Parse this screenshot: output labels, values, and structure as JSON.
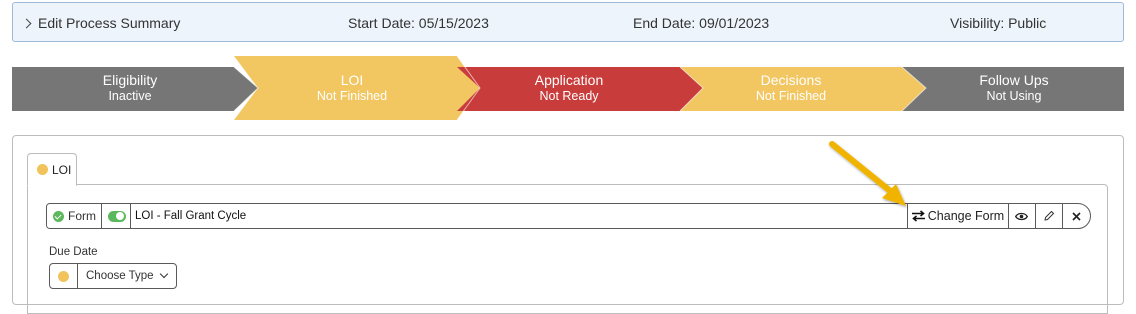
{
  "summary": {
    "toggle_label": "Edit Process Summary",
    "start_date": "Start Date: 05/15/2023",
    "end_date": "End Date: 09/01/2023",
    "visibility": "Visibility: Public"
  },
  "steps": [
    {
      "name": "Eligibility",
      "status": "Inactive",
      "color": "#767676"
    },
    {
      "name": "LOI",
      "status": "Not Finished",
      "color": "#f2c661"
    },
    {
      "name": "Application",
      "status": "Not Ready",
      "color": "#c93c3c"
    },
    {
      "name": "Decisions",
      "status": "Not Finished",
      "color": "#f2c661"
    },
    {
      "name": "Follow Ups",
      "status": "Not Using",
      "color": "#767676"
    }
  ],
  "tab": {
    "label": "LOI",
    "dot_color": "#f1c35a"
  },
  "form": {
    "type_label": "Form",
    "name": "LOI - Fall Grant Cycle",
    "change_label": "Change Form",
    "icons": [
      "swap-icon",
      "eye-icon",
      "pencil-icon",
      "close-icon"
    ]
  },
  "due_date": {
    "label": "Due Date",
    "select_value": "Choose Type"
  },
  "annotation": {
    "arrow_color": "#f0b400"
  }
}
